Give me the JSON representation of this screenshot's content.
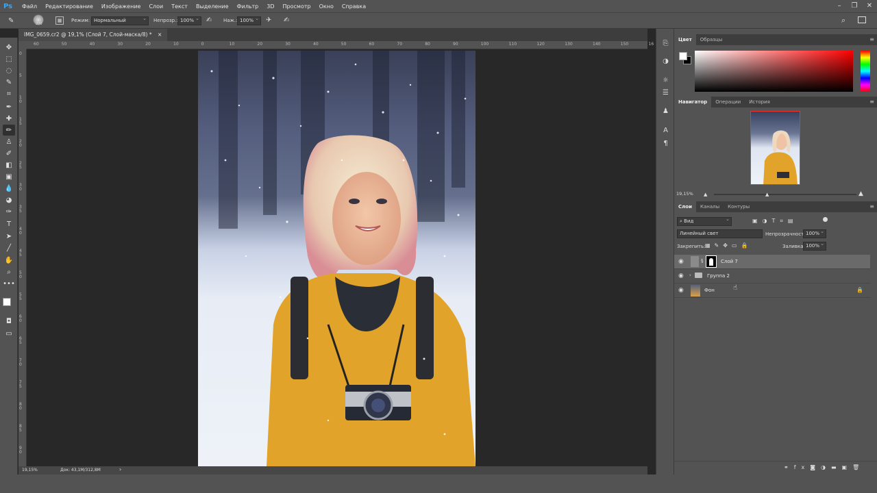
{
  "app": {
    "logo": "Ps"
  },
  "menu": [
    "Файл",
    "Редактирование",
    "Изображение",
    "Слои",
    "Текст",
    "Выделение",
    "Фильтр",
    "3D",
    "Просмотр",
    "Окно",
    "Справка"
  ],
  "options": {
    "brush_size": "200",
    "mode_label": "Режим:",
    "mode_value": "Нормальный",
    "opacity_label": "Непрозр.:",
    "opacity_value": "100%",
    "pressure_label": "Наж.:",
    "pressure_value": "100%"
  },
  "document": {
    "tab_title": "IMG_0659.cr2 @ 19,1% (Слой 7, Слой-маска/8) *",
    "close": "×"
  },
  "ruler_h": [
    "60",
    "50",
    "40",
    "30",
    "20",
    "10",
    "0",
    "10",
    "20",
    "30",
    "40",
    "50",
    "60",
    "70",
    "80",
    "90",
    "100",
    "110",
    "120",
    "130",
    "140",
    "150",
    "16"
  ],
  "ruler_v": [
    "0",
    "5",
    "1 0",
    "1 5",
    "2 0",
    "2 5",
    "3 0",
    "3 5",
    "4 0",
    "4 5",
    "5 0",
    "5 5",
    "6 0",
    "6 5",
    "7 0",
    "7 5",
    "8 0",
    "8 5",
    "9 0"
  ],
  "status": {
    "zoom": "19,15%",
    "doc": "Док: 43,1M/312,8M",
    "arrow": "›"
  },
  "color_panel": {
    "tabs": [
      "Цвет",
      "Образцы"
    ]
  },
  "navigator": {
    "tabs": [
      "Навигатор",
      "Операции",
      "История"
    ],
    "zoom": "19,15%"
  },
  "layers_panel": {
    "tabs": [
      "Слои",
      "Каналы",
      "Контуры"
    ],
    "filter": "Вид",
    "blend_mode": "Линейный свет",
    "opacity_label": "Непрозрачность:",
    "opacity": "100%",
    "lock_label": "Закрепить:",
    "fill_label": "Заливка:",
    "fill": "100%",
    "layers": [
      {
        "name": "Слой 7",
        "selected": true
      },
      {
        "name": "Группа 2",
        "selected": false
      },
      {
        "name": "Фон",
        "selected": false,
        "locked": true
      }
    ]
  },
  "icons": {
    "menu": "hamburger-icon",
    "search": "search-icon",
    "workspace": "workspace-icon"
  }
}
